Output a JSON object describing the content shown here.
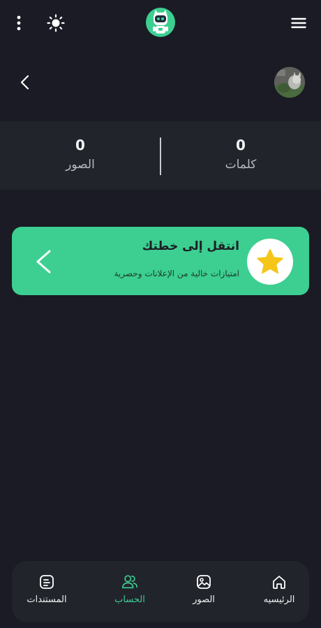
{
  "header": {
    "more_icon": "vertical-dots-icon",
    "theme_icon": "sun-icon",
    "logo_icon": "robot-logo-icon",
    "menu_icon": "hamburger-menu-icon"
  },
  "profile": {
    "back_icon": "chevron-left-icon",
    "avatar": "profile-photo"
  },
  "stats": {
    "photos": {
      "value": "0",
      "label": "الصور"
    },
    "words": {
      "value": "0",
      "label": "كلمات"
    }
  },
  "plan_card": {
    "title": "انتقل إلى خطتك",
    "subtitle": "امتيازات خالية من الإعلانات وحصرية",
    "icon": "star-icon",
    "arrow_icon": "chevron-left-icon"
  },
  "bottom_nav": {
    "items": [
      {
        "label": "المستندات",
        "icon": "document-icon",
        "active": false
      },
      {
        "label": "الحساب",
        "icon": "users-icon",
        "active": true
      },
      {
        "label": "الصور",
        "icon": "image-icon",
        "active": false
      },
      {
        "label": "الرئيسيه",
        "icon": "home-icon",
        "active": false
      }
    ]
  },
  "colors": {
    "background": "#1a1b24",
    "surface": "#22242c",
    "accent": "#3ccf91",
    "star": "#f5c518"
  }
}
